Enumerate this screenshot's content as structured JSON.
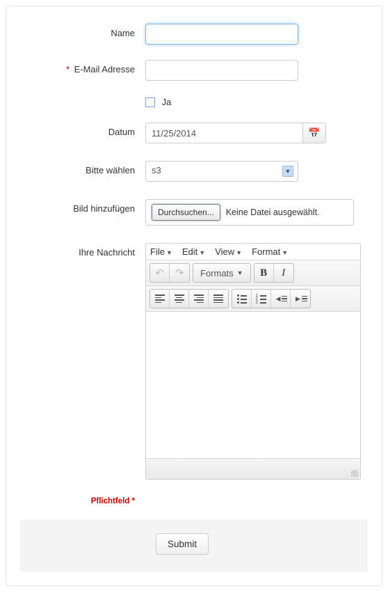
{
  "fields": {
    "name": {
      "label": "Name",
      "value": ""
    },
    "email": {
      "label": "E-Mail Adresse",
      "value": ""
    },
    "checkbox": {
      "label": "Ja"
    },
    "datum": {
      "label": "Datum",
      "value": "11/25/2014"
    },
    "select": {
      "label": "Bitte wählen",
      "value": "s3"
    },
    "file": {
      "label": "Bild hinzufügen",
      "browse_label": "Durchsuchen...",
      "status": "Keine Datei ausgewählt."
    },
    "message": {
      "label": "Ihre Nachricht"
    }
  },
  "editor": {
    "menus": {
      "file": "File",
      "edit": "Edit",
      "view": "View",
      "format": "Format"
    },
    "formats_label": "Formats"
  },
  "required_note": "Pflichtfeld *",
  "submit_label": "Submit"
}
